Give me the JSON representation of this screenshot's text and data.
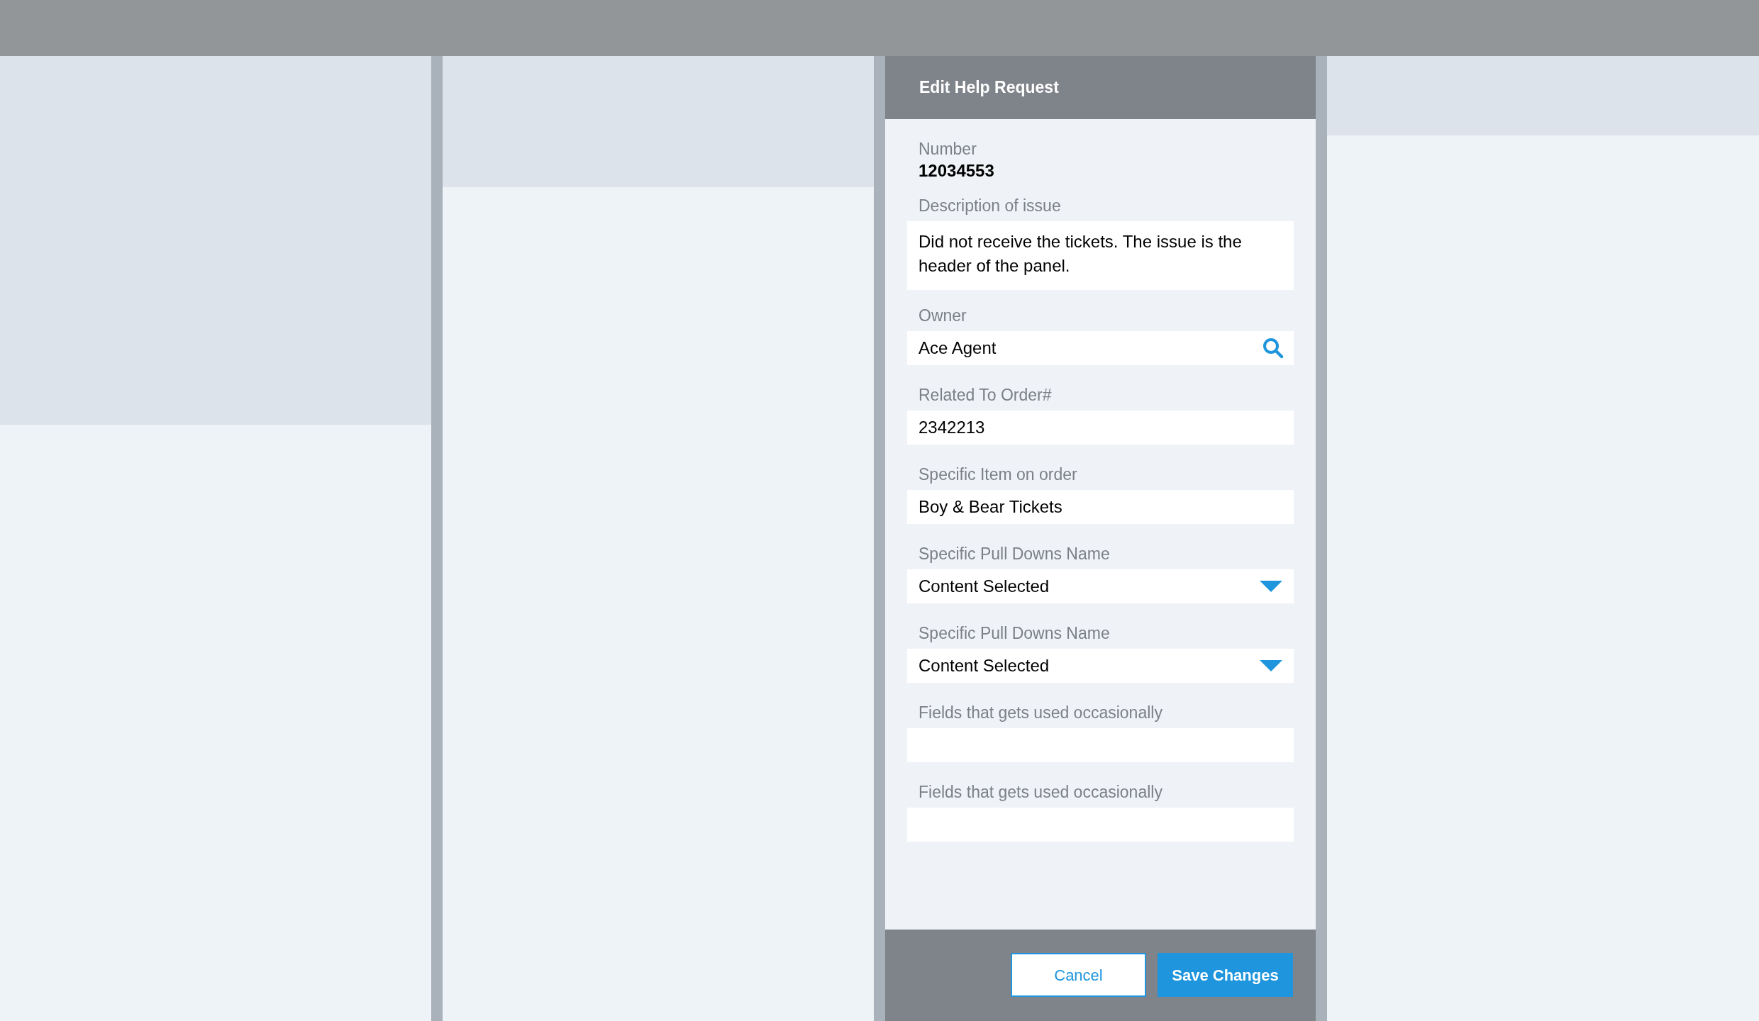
{
  "panel": {
    "title": "Edit Help Request",
    "fields": [
      {
        "kind": "static",
        "label": "Number",
        "value": "12034553"
      },
      {
        "kind": "textarea",
        "label": "Description of issue",
        "value": "Did not receive the tickets. The issue is the header of the panel."
      },
      {
        "kind": "search",
        "label": "Owner",
        "value": "Ace Agent"
      },
      {
        "kind": "text",
        "label": "Related To Order#",
        "value": "2342213"
      },
      {
        "kind": "text",
        "label": "Specific Item on order",
        "value": "Boy & Bear Tickets"
      },
      {
        "kind": "dropdown",
        "label": "Specific Pull Downs Name",
        "value": "Content Selected"
      },
      {
        "kind": "dropdown",
        "label": "Specific Pull Downs Name",
        "value": "Content Selected"
      },
      {
        "kind": "text",
        "label": "Fields that gets used occasionally"
      },
      {
        "kind": "text",
        "label": "Fields that gets used occasionally"
      }
    ],
    "buttons": [
      {
        "kind": "secondary",
        "label": "Cancel"
      },
      {
        "kind": "primary",
        "label": "Save Changes"
      }
    ]
  }
}
